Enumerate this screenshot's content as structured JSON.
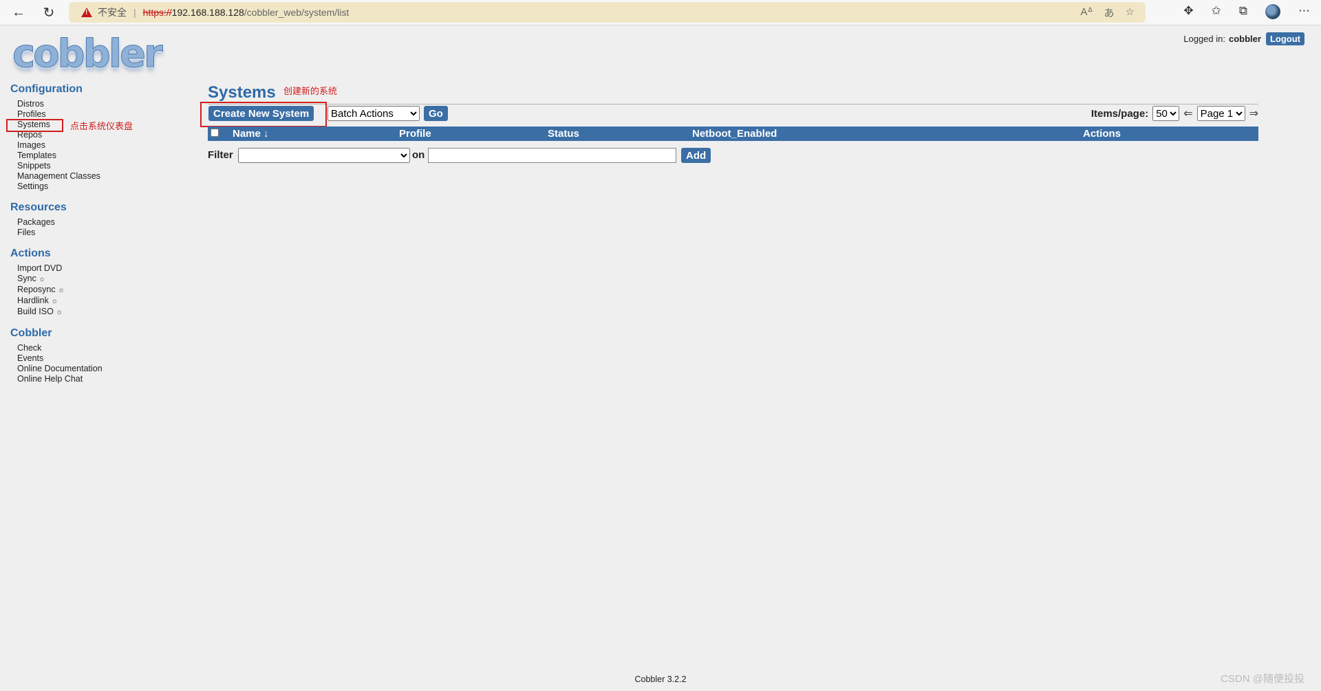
{
  "browser": {
    "back_icon": "←",
    "refresh_icon": "↻",
    "warning_text": "不安全",
    "url_scheme": "https://",
    "url_host": "192.168.188.128",
    "url_path": "/cobbler_web/system/list"
  },
  "header": {
    "logo_text": "cobbler",
    "logged_in_label": "Logged in:",
    "username": "cobbler",
    "logout_label": "Logout"
  },
  "sidebar": {
    "configuration": {
      "heading": "Configuration",
      "items": [
        "Distros",
        "Profiles",
        "Systems",
        "Repos",
        "Images",
        "Templates",
        "Snippets",
        "Management Classes",
        "Settings"
      ]
    },
    "resources": {
      "heading": "Resources",
      "items": [
        "Packages",
        "Files"
      ]
    },
    "actions": {
      "heading": "Actions",
      "items": [
        "Import DVD",
        "Sync",
        "Reposync",
        "Hardlink",
        "Build ISO"
      ],
      "gear_icon": "☼"
    },
    "cobbler": {
      "heading": "Cobbler",
      "items": [
        "Check",
        "Events",
        "Online Documentation",
        "Online Help Chat"
      ]
    }
  },
  "annotations": {
    "systems_note": "点击系统仪表盘",
    "create_note": "创建新的系统"
  },
  "main": {
    "title": "Systems",
    "create_button": "Create New System",
    "batch_actions": "Batch Actions",
    "go_button": "Go",
    "items_per_page_label": "Items/page:",
    "items_per_page_value": "50",
    "page_value": "Page 1",
    "prev_arrow": "⇐",
    "next_arrow": "⇒",
    "columns": [
      "Name ↓",
      "Profile",
      "Status",
      "Netboot_Enabled",
      "Actions"
    ],
    "filter_label": "Filter",
    "on_label": "on",
    "add_button": "Add"
  },
  "footer": {
    "version": "Cobbler 3.2.2",
    "watermark": "CSDN @随便投投"
  },
  "colors": {
    "accent": "#3a6ea5",
    "heading": "#2e6aa8",
    "annotation": "#d21e1e"
  }
}
